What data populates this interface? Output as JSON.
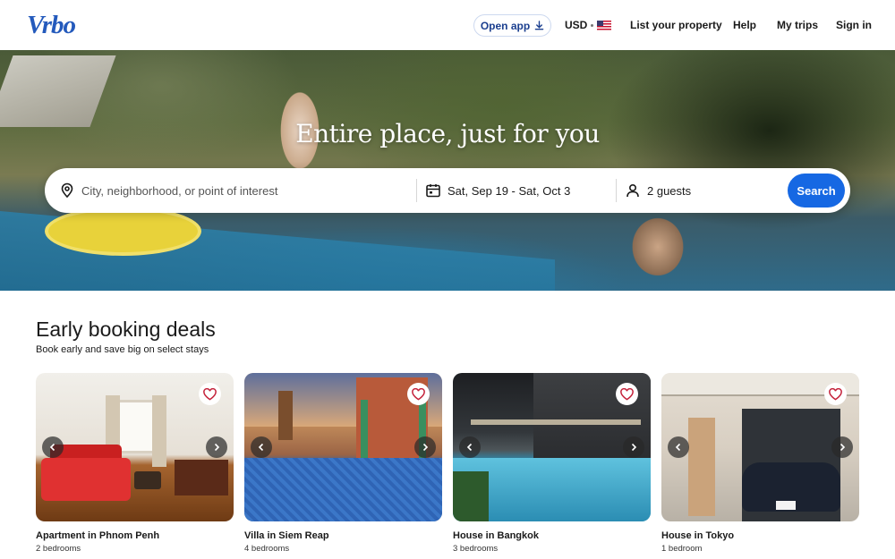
{
  "header": {
    "logo": "Vrbo",
    "open_app": "Open app",
    "currency": "USD",
    "nav": {
      "list_property": "List your property",
      "help": "Help",
      "my_trips": "My trips",
      "sign_in": "Sign in"
    }
  },
  "hero": {
    "title": "Entire place, just for you"
  },
  "search": {
    "destination_placeholder": "City, neighborhood, or point of interest",
    "dates": "Sat, Sep 19 - Sat, Oct 3",
    "guests": "2 guests",
    "button": "Search"
  },
  "deals": {
    "title": "Early booking deals",
    "subtitle": "Book early and save big on select stays",
    "cards": [
      {
        "title": "Apartment in Phnom Penh",
        "sub": "2 bedrooms"
      },
      {
        "title": "Villa in Siem Reap",
        "sub": "4 bedrooms"
      },
      {
        "title": "House in Bangkok",
        "sub": "3 bedrooms"
      },
      {
        "title": "House in Tokyo",
        "sub": "1 bedroom"
      }
    ]
  },
  "colors": {
    "brand": "#245abc",
    "search_button": "#1668e3",
    "heart": "#c4213a"
  }
}
